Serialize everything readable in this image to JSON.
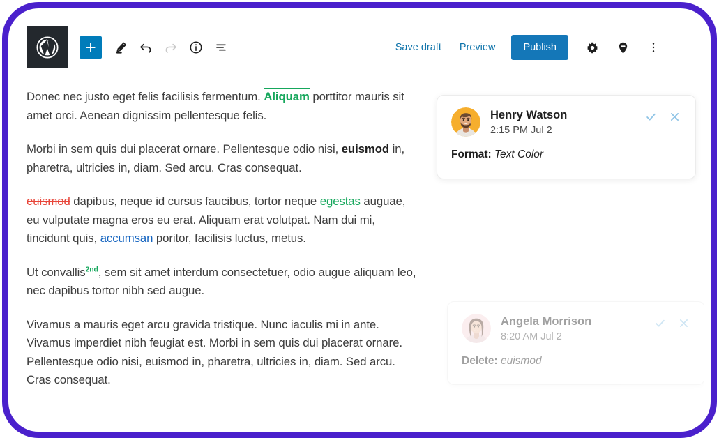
{
  "frame": {
    "border_color": "#4A20CC"
  },
  "toolbar": {
    "logo_name": "wordpress-logo",
    "left_tools": [
      {
        "name": "add-block-button",
        "icon": "plus-icon",
        "label": "Add block",
        "state": "primary"
      },
      {
        "name": "edit-tool-button",
        "icon": "pencil-icon",
        "label": "Edit",
        "state": "normal"
      },
      {
        "name": "undo-button",
        "icon": "undo-arrow-icon",
        "label": "Undo",
        "state": "normal"
      },
      {
        "name": "redo-button",
        "icon": "redo-arrow-icon",
        "label": "Redo",
        "state": "disabled"
      },
      {
        "name": "details-button",
        "icon": "info-circle-icon",
        "label": "Details",
        "state": "normal"
      },
      {
        "name": "list-view-button",
        "icon": "list-view-icon",
        "label": "List view",
        "state": "normal"
      }
    ],
    "save_draft_label": "Save draft",
    "preview_label": "Preview",
    "publish_label": "Publish",
    "settings_icon": "gear-icon",
    "comments_icon": "comment-pin-icon",
    "more_icon": "more-vertical-icon",
    "accent_blue": "#1477b8",
    "link_blue": "#0f74ab"
  },
  "document": {
    "paragraphs": [
      {
        "id": "paragraph-1",
        "runs": [
          {
            "text": "Donec nec justo eget felis facilisis fermentum. ",
            "style": "plain"
          },
          {
            "text": "Aliquam",
            "style": "green-bold-marked"
          },
          {
            "text": " porttitor mauris sit amet orci. Aenean dignissim pellentesque felis.",
            "style": "plain"
          }
        ]
      },
      {
        "id": "paragraph-2",
        "runs": [
          {
            "text": "Morbi in sem quis dui placerat ornare. Pellentesque odio nisi, ",
            "style": "plain"
          },
          {
            "text": "euismod",
            "style": "bold"
          },
          {
            "text": " in, pharetra, ultricies in, diam. Sed arcu. Cras consequat.",
            "style": "plain"
          }
        ]
      },
      {
        "id": "paragraph-3",
        "runs": [
          {
            "text": "euismod",
            "style": "strike-red"
          },
          {
            "text": " dapibus, neque id cursus faucibus, tortor neque ",
            "style": "plain"
          },
          {
            "text": "egestas",
            "style": "link-green"
          },
          {
            "text": " auguae, eu vulputate magna eros eu erat. Aliquam erat volutpat. Nam dui mi, tincidunt quis, ",
            "style": "plain"
          },
          {
            "text": "accumsan",
            "style": "link-blue"
          },
          {
            "text": " poritor, facilisis luctus, metus.",
            "style": "plain"
          }
        ]
      },
      {
        "id": "paragraph-4",
        "runs": [
          {
            "text": "Ut convallis",
            "style": "plain"
          },
          {
            "text": "2nd",
            "style": "sup-green"
          },
          {
            "text": ", sem sit amet interdum consectetuer, odio augue aliquam leo, nec dapibus tortor nibh sed augue.",
            "style": "plain"
          }
        ]
      },
      {
        "id": "paragraph-5",
        "runs": [
          {
            "text": "Vivamus a mauris eget arcu gravida tristique. Nunc iaculis mi in ante. Vivamus imperdiet nibh feugiat est. Morbi in sem quis dui placerat ornare. Pellentesque odio nisi, euismod in, pharetra, ultricies in, diam. Sed arcu. Cras consequat.",
            "style": "plain"
          }
        ]
      }
    ]
  },
  "comments": [
    {
      "id": "comment-card-1",
      "author": "Henry Watson",
      "timestamp": "2:15 PM Jul 2",
      "body_label": "Format:",
      "body_value": "Text Color",
      "avatar_name": "avatar-henry-watson",
      "avatar_bg": "#F6AE2D",
      "state": "active",
      "resolve_icon": "check-icon",
      "dismiss_icon": "close-icon"
    },
    {
      "id": "comment-card-2",
      "author": "Angela Morrison",
      "timestamp": "8:20 AM Jul 2",
      "body_label": "Delete:",
      "body_value": "euismod",
      "avatar_name": "avatar-angela-morrison",
      "avatar_bg": "#F7D7DA",
      "state": "faded",
      "resolve_icon": "check-icon",
      "dismiss_icon": "close-icon"
    }
  ],
  "colors": {
    "annotation_green": "#16a75c",
    "annotation_red": "#e8463a",
    "annotation_blue": "#1464c0",
    "action_icon_blue": "#8fc4e6"
  }
}
